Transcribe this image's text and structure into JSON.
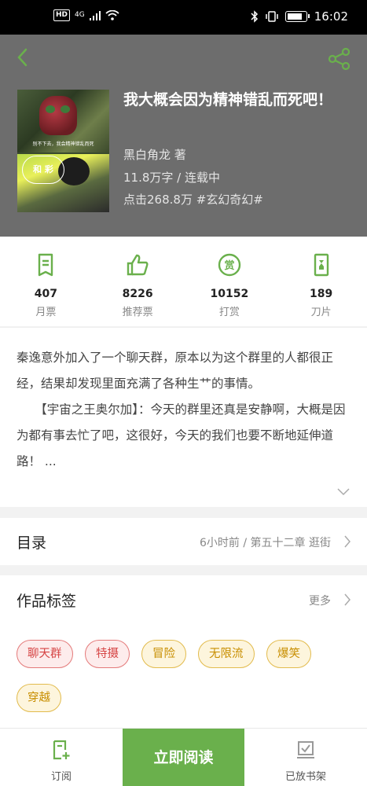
{
  "status_bar": {
    "hd": "HD",
    "network": "4G",
    "time": "16:02",
    "battery_level": 0.85
  },
  "header": {
    "back_icon": "chevron-left-icon",
    "share_icon": "share-icon"
  },
  "book": {
    "title": "我大概会因为精神错乱而死吧！",
    "author": "黑白角龙  著",
    "length_status": "11.8万字 / 连载中",
    "clicks_genre": "点击268.8万  #玄幻奇幻#",
    "cover_caption": "别不下去，我会精神错乱而死",
    "cover_tag": "和 彩"
  },
  "stats": [
    {
      "icon": "ticket-icon",
      "value": "407",
      "label": "月票"
    },
    {
      "icon": "thumbs-up-icon",
      "value": "8226",
      "label": "推荐票"
    },
    {
      "icon": "reward-icon",
      "value": "10152",
      "label": "打赏"
    },
    {
      "icon": "blade-icon",
      "value": "189",
      "label": "刀片"
    }
  ],
  "description": {
    "para1": "秦逸意外加入了一个聊天群，原本以为这个群里的人都很正经，结果却发现里面充满了各种生艹的事情。",
    "para2": "　　【宇宙之王奥尔加】：今天的群里还真是安静啊，大概是因为都有事去忙了吧，这很好，今天的我们也要不断地延伸道路！ ..."
  },
  "toc": {
    "title": "目录",
    "latest": "6小时前 / 第五十二章 逛街"
  },
  "tags_section": {
    "title": "作品标签",
    "more": "更多",
    "tags": [
      {
        "label": "聊天群",
        "color": "red"
      },
      {
        "label": "特摄",
        "color": "red"
      },
      {
        "label": "冒险",
        "color": "yellow"
      },
      {
        "label": "无限流",
        "color": "yellow"
      },
      {
        "label": "爆笑",
        "color": "yellow"
      },
      {
        "label": "穿越",
        "color": "yellow"
      }
    ]
  },
  "bottom_bar": {
    "subscribe": "订阅",
    "read": "立即阅读",
    "shelf": "已放书架"
  },
  "colors": {
    "accent": "#6ab04c",
    "hero_bg": "#6d6d6d",
    "tag_red": "#d64545",
    "tag_yellow": "#c88e00"
  }
}
